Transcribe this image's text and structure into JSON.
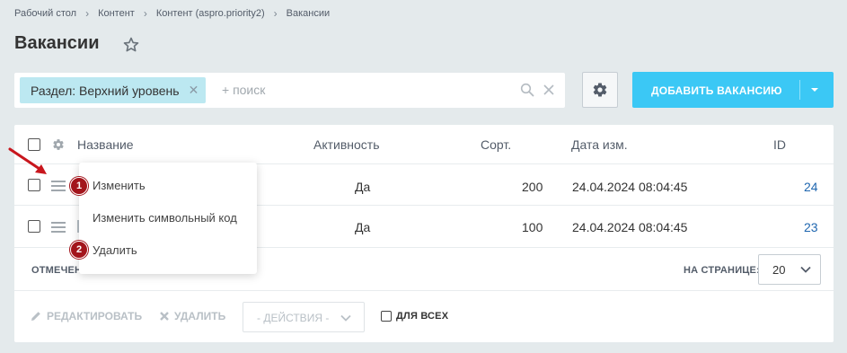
{
  "breadcrumbs": [
    "Рабочий стол",
    "Контент",
    "Контент (aspro.priority2)",
    "Вакансии"
  ],
  "page_title": "Вакансии",
  "filter": {
    "tag_label": "Раздел: Верхний уровень",
    "search_placeholder": "+ поиск"
  },
  "add_button_label": "ДОБАВИТЬ ВАКАНСИЮ",
  "table": {
    "columns": {
      "name": "Название",
      "active": "Активность",
      "sort": "Сорт.",
      "date": "Дата изм.",
      "id": "ID"
    },
    "rows": [
      {
        "active": "Да",
        "sort": "200",
        "date": "24.04.2024 08:04:45",
        "id": "24"
      },
      {
        "active": "Да",
        "sort": "100",
        "date": "24.04.2024 08:04:45",
        "id": "23"
      }
    ]
  },
  "footer": {
    "selected_label": "ОТМЕЧЕН",
    "per_page_label": "НА СТРАНИЦЕ:",
    "per_page_value": "20",
    "edit_label": "РЕДАКТИРОВАТЬ",
    "delete_label": "УДАЛИТЬ",
    "actions_placeholder": "- ДЕЙСТВИЯ -",
    "for_all_label": "ДЛЯ ВСЕХ"
  },
  "context_menu": {
    "items": [
      "Изменить",
      "Изменить символьный код",
      "Удалить"
    ],
    "badges": [
      "1",
      "2"
    ]
  },
  "colors": {
    "accent": "#3bc8f5",
    "filter_tag": "#bce8f1",
    "link": "#2067b0",
    "badge": "#a3151c",
    "background": "#e4eaec"
  },
  "icons": [
    "star-icon",
    "search-icon",
    "clear-icon",
    "gear-icon",
    "chevron-down-icon",
    "burger-menu-icon",
    "pencil-icon",
    "close-icon",
    "arrow-annotation"
  ]
}
